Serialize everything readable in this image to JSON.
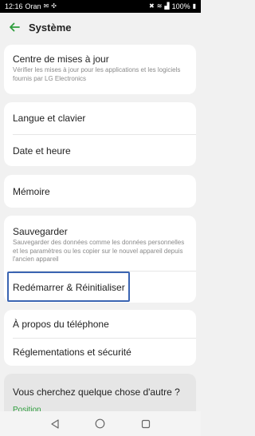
{
  "status_bar": {
    "time": "12:16",
    "carrier": "Oran",
    "battery": "100%"
  },
  "header": {
    "title": "Système"
  },
  "cards": {
    "updates": {
      "title": "Centre de mises à jour",
      "subtitle": "Vérifier les mises à jour pour les applications et les logiciels fournis par LG Electronics"
    },
    "language": {
      "title": "Langue et clavier"
    },
    "datetime": {
      "title": "Date et heure"
    },
    "memory": {
      "title": "Mémoire"
    },
    "backup": {
      "title": "Sauvegarder",
      "subtitle": "Sauvegarder des données comme les données personnelles et les paramètres ou les copier sur le nouvel appareil depuis l'ancien appareil"
    },
    "restart": {
      "title": "Redémarrer & Réinitialiser"
    },
    "about": {
      "title": "À propos du téléphone"
    },
    "regulations": {
      "title": "Réglementations et sécurité"
    }
  },
  "search": {
    "question": "Vous cherchez quelque chose d'autre ?",
    "link": "Position"
  },
  "colors": {
    "accent": "#2e9e3d",
    "highlight": "#3a64b2"
  }
}
